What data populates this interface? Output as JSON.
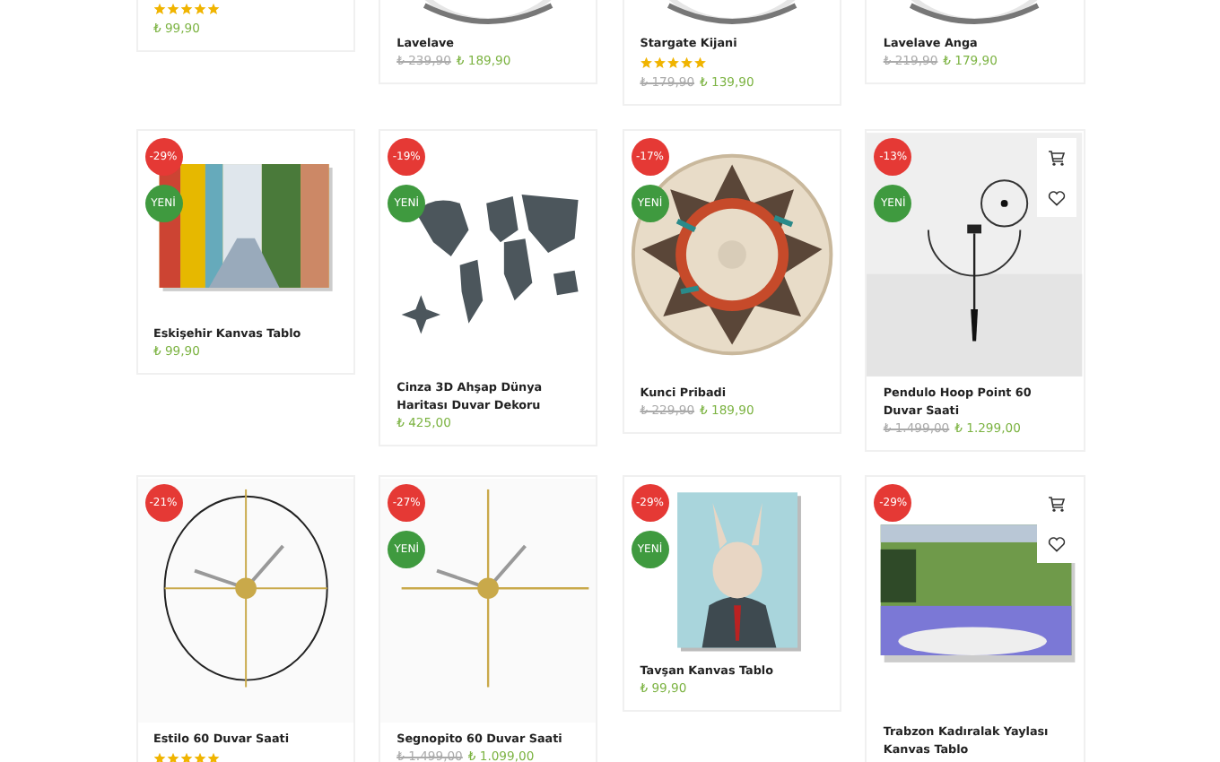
{
  "products": [
    {
      "kind": "frame",
      "stars": 5,
      "price": "₺ 99,90"
    },
    {
      "kind": "bowl",
      "title": "Lavelave",
      "old_price": "₺ 239,90",
      "price": "₺ 189,90"
    },
    {
      "kind": "bowl",
      "title": "Stargate Kijani",
      "stars": 5,
      "old_price": "₺ 179,90",
      "price": "₺ 139,90"
    },
    {
      "kind": "bowl",
      "title": "Lavelave Anga",
      "old_price": "₺ 219,90",
      "price": "₺ 179,90"
    },
    {
      "kind": "painting",
      "discount": "-29%",
      "new_badge": "YENİ",
      "title": "Eskişehir Kanvas Tablo",
      "price": "₺ 99,90",
      "show_actions": false
    },
    {
      "kind": "map",
      "discount": "-19%",
      "new_badge": "YENİ",
      "title": "Cinza 3D Ahşap Dünya Haritası Duvar Dekoru",
      "price": "₺ 425,00",
      "show_actions": false
    },
    {
      "kind": "basket",
      "discount": "-17%",
      "new_badge": "YENİ",
      "title": "Kunci Pribadi",
      "old_price": "₺ 229,90",
      "price": "₺ 189,90",
      "show_actions": false
    },
    {
      "kind": "hoop",
      "discount": "-13%",
      "new_badge": "YENİ",
      "title": "Pendulo Hoop Point 60 Duvar Saati",
      "old_price": "₺ 1.499,00",
      "price": "₺ 1.299,00",
      "show_actions": true
    },
    {
      "kind": "clock",
      "discount": "-21%",
      "title": "Estilo 60 Duvar Saati",
      "stars": 5,
      "show_actions": false
    },
    {
      "kind": "cross",
      "discount": "-27%",
      "new_badge": "YENİ",
      "title": "Segnopito 60 Duvar Saati",
      "old_price": "₺ 1.499,00",
      "price": "₺ 1.099,00",
      "show_actions": false
    },
    {
      "kind": "portrait",
      "discount": "-29%",
      "new_badge": "YENİ",
      "title": "Tavşan Kanvas Tablo",
      "price": "₺ 99,90",
      "show_actions": false
    },
    {
      "kind": "landscape",
      "discount": "-29%",
      "title": "Trabzon Kadıralak Yaylası Kanvas Tablo",
      "show_actions": true
    }
  ]
}
